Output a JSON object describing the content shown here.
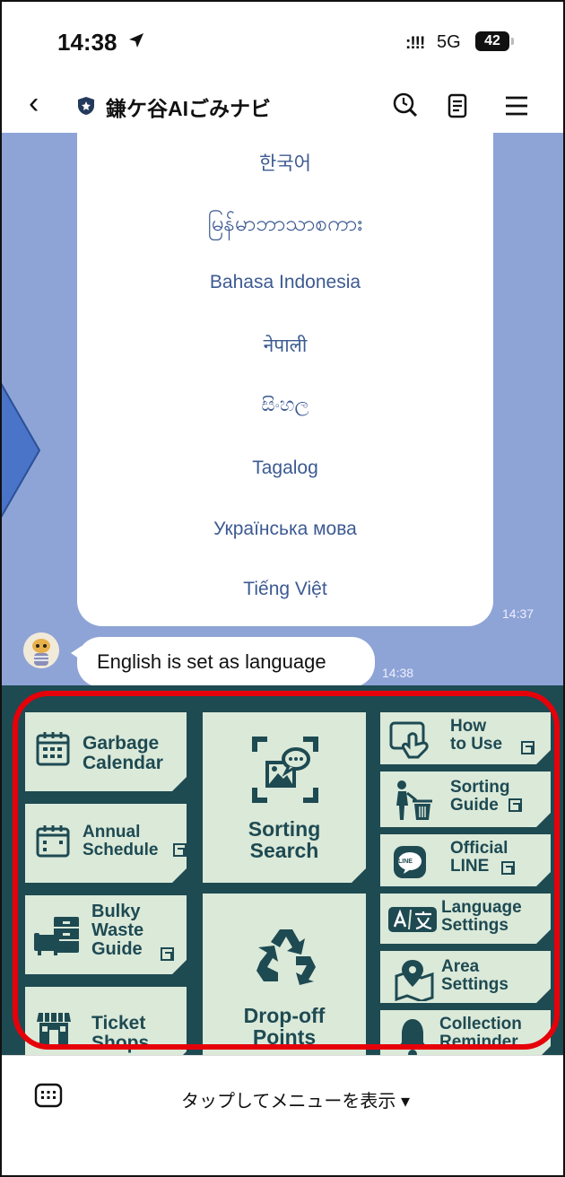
{
  "status": {
    "time": "14:38",
    "signal": ":!!!",
    "network": "5G",
    "battery": "42"
  },
  "nav": {
    "title": "鎌ケ谷AIごみナビ"
  },
  "chat": {
    "languages": [
      "한국어",
      "မြန်မာဘာသာစကား",
      "Bahasa Indonesia",
      "नेपाली",
      "සිංහල",
      "Tagalog",
      "Українська мова",
      "Tiếng Việt"
    ],
    "card_time": "14:37",
    "message": "English is set as language",
    "message_time": "14:38"
  },
  "menu": {
    "garbage_calendar": "Garbage\nCalendar",
    "annual_schedule": "Annual\nSchedule",
    "sorting_search": "Sorting\nSearch",
    "how_to_use": "How\nto Use",
    "sorting_guide": "Sorting\nGuide",
    "official_line": "Official\nLINE",
    "line_badge": "LINE",
    "bulky_waste": "Bulky\nWaste\nGuide",
    "ticket_shops": "Ticket\nShops",
    "drop_off": "Drop-off\nPoints",
    "language_settings": "Language\nSettings",
    "area_settings": "Area\nSettings",
    "collection_reminder": "Collection\nReminder"
  },
  "bottom": {
    "tap_text": "タップしてメニューを表示 ▾"
  },
  "colors": {
    "chat_bg": "#8ea4d6",
    "menu_bg": "#1e4a52",
    "tile_bg": "#dbe9d9",
    "highlight": "#e6000a"
  }
}
